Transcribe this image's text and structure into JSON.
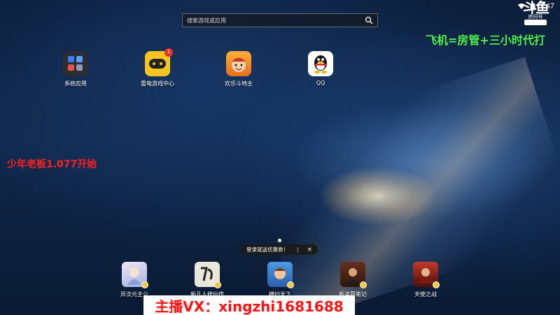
{
  "statusbar": {
    "time": "7:47"
  },
  "search": {
    "placeholder": "搜索游戏或应用"
  },
  "watermark": {
    "big": "斗鱼",
    "small": "房间号"
  },
  "overlays": {
    "green_text": "飞机=房管+三小时代打",
    "red_text": "少年老板1.077开始",
    "bottom_banner": "主播VX：xingzhi1681688"
  },
  "apps": [
    {
      "label": "系统应用",
      "icon": "system-apps-folder-icon"
    },
    {
      "label": "雷电游戏中心",
      "icon": "ld-game-center-icon",
      "badge": "1"
    },
    {
      "label": "欢乐斗地主",
      "icon": "doudizhu-icon"
    },
    {
      "label": "QQ",
      "icon": "qq-penguin-icon"
    }
  ],
  "promo": {
    "text": "登录就送优惠券！",
    "close": "×"
  },
  "dock": [
    {
      "label": "异次元主公",
      "icon": "game-1-icon"
    },
    {
      "label": "新凡人修仙传",
      "icon": "game-2-icon"
    },
    {
      "label": "横扫天下",
      "icon": "game-3-icon"
    },
    {
      "label": "新盗墓笔记",
      "icon": "game-4-icon"
    },
    {
      "label": "天使之战",
      "icon": "game-5-icon"
    }
  ],
  "colors": {
    "green_overlay": "#4ef04a",
    "red_overlay": "#ff2020",
    "badge": "#e9332a"
  }
}
